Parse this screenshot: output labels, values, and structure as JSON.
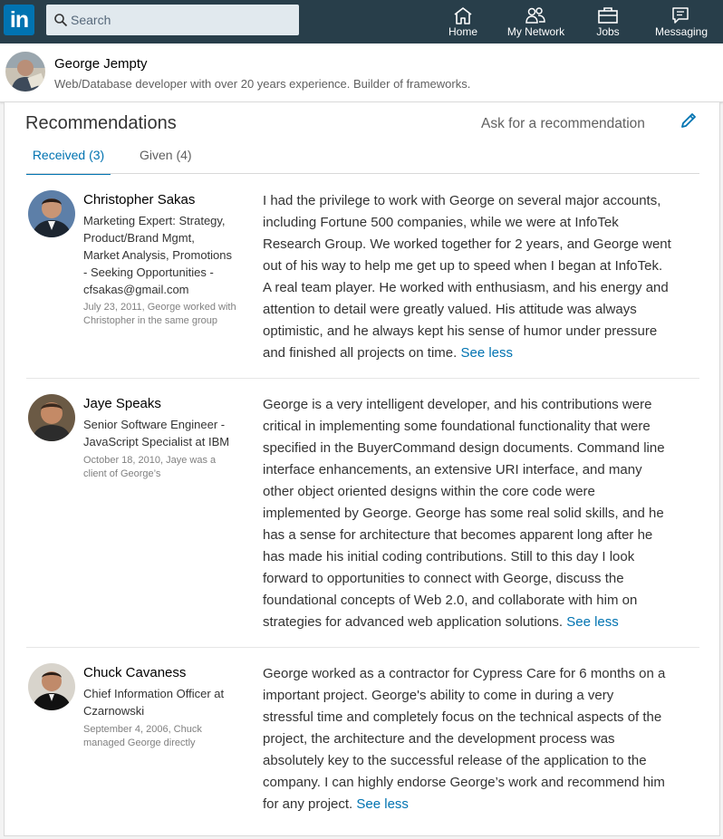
{
  "nav": {
    "logo": "in",
    "search_placeholder": "Search",
    "items": [
      {
        "label": "Home",
        "icon": "home-icon"
      },
      {
        "label": "My Network",
        "icon": "network-icon"
      },
      {
        "label": "Jobs",
        "icon": "briefcase-icon"
      },
      {
        "label": "Messaging",
        "icon": "messaging-icon"
      }
    ]
  },
  "profile": {
    "name": "George Jempty",
    "tagline": "Web/Database developer with over 20 years experience. Builder of frameworks."
  },
  "recommendations": {
    "title": "Recommendations",
    "ask_label": "Ask for a recommendation",
    "tabs": [
      {
        "label": "Received (3)",
        "active": true
      },
      {
        "label": "Given (4)",
        "active": false
      }
    ],
    "see_less": "See less",
    "items": [
      {
        "name": "Christopher Sakas",
        "title": "Marketing Expert: Strategy, Product/Brand Mgmt, Market Analysis, Promotions - Seeking Opportunities - cfsakas@gmail.com",
        "title_lines": [
          "Marketing Expert: Strategy,",
          "Product/Brand Mgmt,",
          "Market Analysis, Promotions",
          "- Seeking Opportunities -",
          "cfsakas@gmail.com"
        ],
        "date_lines": [
          "July 23, 2011, George worked with",
          "Christopher in the same group"
        ],
        "text_lines": [
          "I had the privilege to work with George on several major accounts,",
          "including Fortune 500 companies, while we were at InfoTek",
          "Research Group. We worked together for 2 years, and George went",
          "out of his way to help me get up to speed when I began at InfoTek.",
          "A real team player. He worked with enthusiasm, and his energy and",
          "attention to detail were greatly valued. His attitude was always",
          "optimistic, and he always kept his sense of humor under pressure",
          "and finished all projects on time."
        ]
      },
      {
        "name": "Jaye Speaks",
        "title_lines": [
          "Senior Software Engineer -",
          "JavaScript Specialist at IBM"
        ],
        "date_lines": [
          "October 18, 2010, Jaye was a",
          "client of George’s"
        ],
        "text_lines": [
          "George is a very intelligent developer, and his contributions were",
          "critical in implementing some foundational functionality that were",
          "specified in the BuyerCommand design documents. Command line",
          "interface enhancements, an extensive URI interface, and many",
          "other object oriented designs within the core code were",
          "implemented by George. George has some real solid skills, and he",
          "has a sense for architecture that becomes apparent long after he",
          "has made his initial coding contributions. Still to this day I look",
          "forward to opportunities to connect with George, discuss the",
          "foundational concepts of Web 2.0, and collaborate with him on",
          "strategies for advanced web application solutions."
        ]
      },
      {
        "name": "Chuck Cavaness",
        "title_lines": [
          "Chief Information Officer at",
          "Czarnowski"
        ],
        "date_lines": [
          "September 4, 2006, Chuck",
          "managed George directly"
        ],
        "text_lines": [
          "George worked as a contractor for Cypress Care for 6 months on a",
          "important project. George's ability to come in during a very",
          "stressful time and completely focus on the technical aspects of the",
          "project, the architecture and the development process was",
          "absolutely key to the successful release of the application to the",
          "company. I can highly endorse George’s work and recommend him",
          "for any project."
        ]
      }
    ]
  }
}
